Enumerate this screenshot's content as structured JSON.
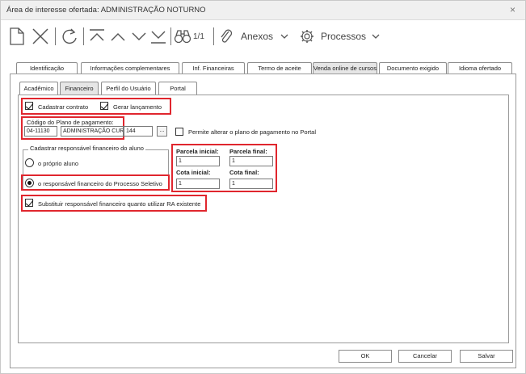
{
  "window": {
    "title": "Área de interesse ofertada: ADMINISTRAÇÃO NOTURNO",
    "close_symbol": "×"
  },
  "toolbar": {
    "icons": [
      "new-document-icon",
      "delete-icon",
      "refresh-icon",
      "first-icon",
      "previous-icon",
      "next-icon",
      "last-icon",
      "binoculars-icon",
      "attachment-icon",
      "gear-icon"
    ],
    "record_counter": "1/1",
    "attachments_label": "Anexos",
    "processes_label": "Processos"
  },
  "tabs": [
    {
      "label": "Identificação"
    },
    {
      "label": "Informações complementares"
    },
    {
      "label": "Inf. Financeiras"
    },
    {
      "label": "Termo de aceite"
    },
    {
      "label": "Venda online de cursos"
    },
    {
      "label": "Documento exigido"
    },
    {
      "label": "Idioma ofertado"
    }
  ],
  "subtabs": [
    {
      "label": "Acadêmico"
    },
    {
      "label": "Financeiro"
    },
    {
      "label": "Perfil do Usuário"
    },
    {
      "label": "Portal"
    }
  ],
  "form": {
    "cadastrar_contrato": {
      "label": "Cadastrar contrato",
      "checked": true
    },
    "gerar_lancamento": {
      "label": "Gerar lançamento",
      "checked": true
    },
    "plano_label": "Código do Plano de pagamento:",
    "plano_code": "04-11130",
    "plano_name": "ADMINISTRAÇÃO CUR",
    "plano_extra": "144",
    "ellipsis": "...",
    "permite_alterar": {
      "label": "Permite alterar o plano de pagamento no Portal",
      "checked": false
    },
    "group_title": "Cadastrar responsável financeiro do aluno",
    "radio_proprio": {
      "label": "o próprio aluno",
      "checked": false
    },
    "radio_processo": {
      "label": "o responsável financeiro do Processo Seletivo",
      "checked": true
    },
    "parcela_inicial_label": "Parcela inicial:",
    "parcela_inicial_value": "1",
    "parcela_final_label": "Parcela final:",
    "parcela_final_value": "1",
    "cota_inicial_label": "Cota inicial:",
    "cota_inicial_value": "1",
    "cota_final_label": "Cota final:",
    "cota_final_value": "1",
    "substituir": {
      "label": "Substituir responsável financeiro quanto utilizar RA existente",
      "checked": true
    }
  },
  "buttons": {
    "ok": "OK",
    "cancel": "Cancelar",
    "save": "Salvar"
  },
  "colors": {
    "highlight": "#e0262e",
    "active_tab": "#e6e6e6"
  }
}
